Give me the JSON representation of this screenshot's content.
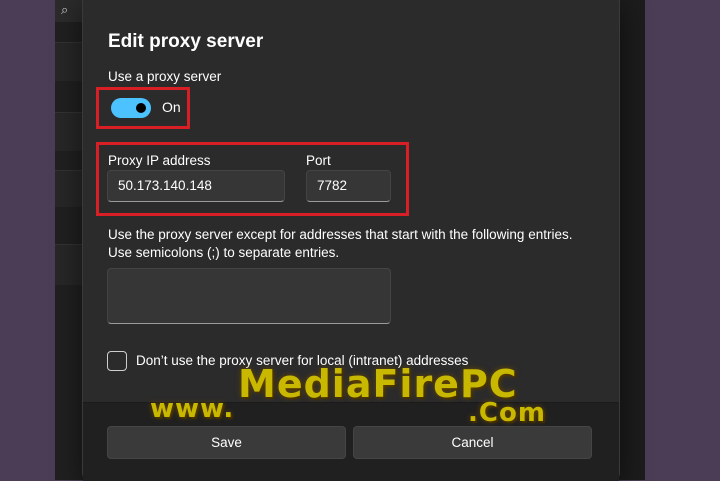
{
  "dialog": {
    "title": "Edit proxy server",
    "use_proxy_label": "Use a proxy server",
    "toggle_state": "On",
    "toggle_on": true,
    "proxy_ip_label": "Proxy IP address",
    "proxy_ip_value": "50.173.140.148",
    "port_label": "Port",
    "port_value": "7782",
    "exceptions_line1": "Use the proxy server except for addresses that start with the following entries.",
    "exceptions_line2": "Use semicolons (;) to separate entries.",
    "exceptions_value": "",
    "local_checkbox_label": "Don’t use the proxy server for local (intranet) addresses",
    "local_checkbox_checked": false,
    "save_label": "Save",
    "cancel_label": "Cancel"
  },
  "background": {
    "search_icon": "search-icon"
  },
  "watermark": {
    "www": "www.",
    "brand": "MediaFirePC",
    "com": ".Com"
  },
  "colors": {
    "accent": "#4cc2ff",
    "highlight_border": "#d91f26",
    "dialog_bg": "#2b2b2b"
  }
}
